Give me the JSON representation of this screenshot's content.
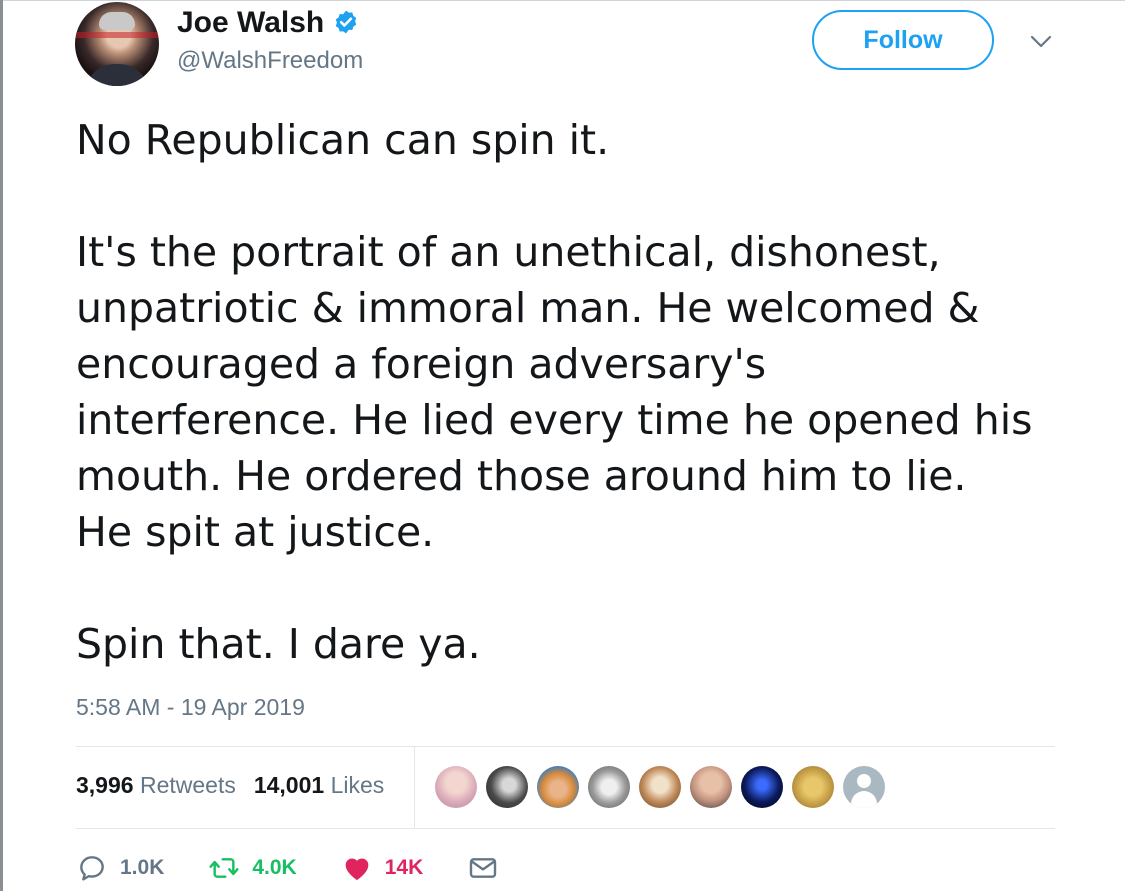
{
  "author": {
    "name": "Joe Walsh",
    "handle": "@WalshFreedom",
    "verified": true,
    "verified_icon": "verified-badge-icon"
  },
  "follow_button": {
    "label": "Follow"
  },
  "menu_icon": "chevron-down-icon",
  "tweet": {
    "paragraphs": [
      "No Republican can spin it.",
      "It's the portrait of an unethical, dishonest,\nunpatriotic & immoral man. He welcomed &\nencouraged a foreign adversary's\ninterference. He lied every time he opened his\nmouth. He ordered those around him to lie.\nHe spit at justice.",
      "Spin that. I dare ya."
    ],
    "timestamp": "5:58 AM - 19 Apr 2019"
  },
  "stats": {
    "retweets_count": "3,996",
    "retweets_label": "Retweets",
    "likes_count": "14,001",
    "likes_label": "Likes"
  },
  "likers": [
    {
      "icon": "liker-avatar-1",
      "color": "#d9a9b8"
    },
    {
      "icon": "liker-avatar-2",
      "color": "#4a4a4a"
    },
    {
      "icon": "liker-avatar-3",
      "color": "#d98b3a"
    },
    {
      "icon": "liker-avatar-4",
      "color": "#9a9a9a"
    },
    {
      "icon": "liker-avatar-5",
      "color": "#c08a5a"
    },
    {
      "icon": "liker-avatar-6",
      "color": "#c49480"
    },
    {
      "icon": "liker-avatar-7",
      "color": "#0b1a5c"
    },
    {
      "icon": "liker-avatar-8",
      "color": "#c9a24a"
    },
    {
      "icon": "liker-avatar-default",
      "color": "#aab8c2"
    }
  ],
  "actions": {
    "reply": {
      "count": "1.0K",
      "icon": "reply-icon"
    },
    "retweet": {
      "count": "4.0K",
      "icon": "retweet-icon"
    },
    "like": {
      "count": "14K",
      "icon": "heart-icon"
    },
    "dm": {
      "icon": "envelope-icon"
    }
  },
  "colors": {
    "accent": "#1da1f2",
    "retweet": "#17bf63",
    "like": "#e0245e",
    "muted": "#657786"
  }
}
